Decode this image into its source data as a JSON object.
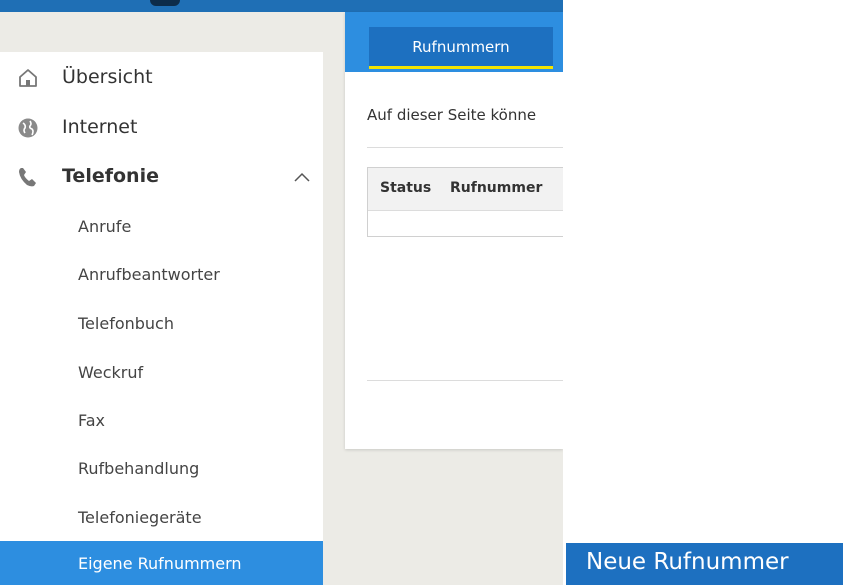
{
  "sidebar": {
    "items": [
      {
        "label": "Übersicht",
        "icon": "home-icon"
      },
      {
        "label": "Internet",
        "icon": "globe-icon"
      },
      {
        "label": "Telefonie",
        "icon": "phone-icon"
      }
    ],
    "telefonie_subitems": [
      {
        "label": "Anrufe"
      },
      {
        "label": "Anrufbeantworter"
      },
      {
        "label": "Telefonbuch"
      },
      {
        "label": "Weckruf"
      },
      {
        "label": "Fax"
      },
      {
        "label": "Rufbehandlung"
      },
      {
        "label": "Telefoniegeräte"
      },
      {
        "label": "Eigene Rufnummern"
      }
    ]
  },
  "content": {
    "tabs": [
      {
        "label": "Rufnummern"
      }
    ],
    "intro_text": "Auf dieser Seite könne",
    "table": {
      "columns": [
        "Status",
        "Rufnummer"
      ]
    }
  },
  "actions": {
    "new_number_label": "Neue Rufnummer"
  },
  "colors": {
    "accent_blue": "#2d8ee0",
    "dark_blue": "#1d70c0",
    "tab_underline": "#f3e300",
    "background": "#ecebe6"
  }
}
